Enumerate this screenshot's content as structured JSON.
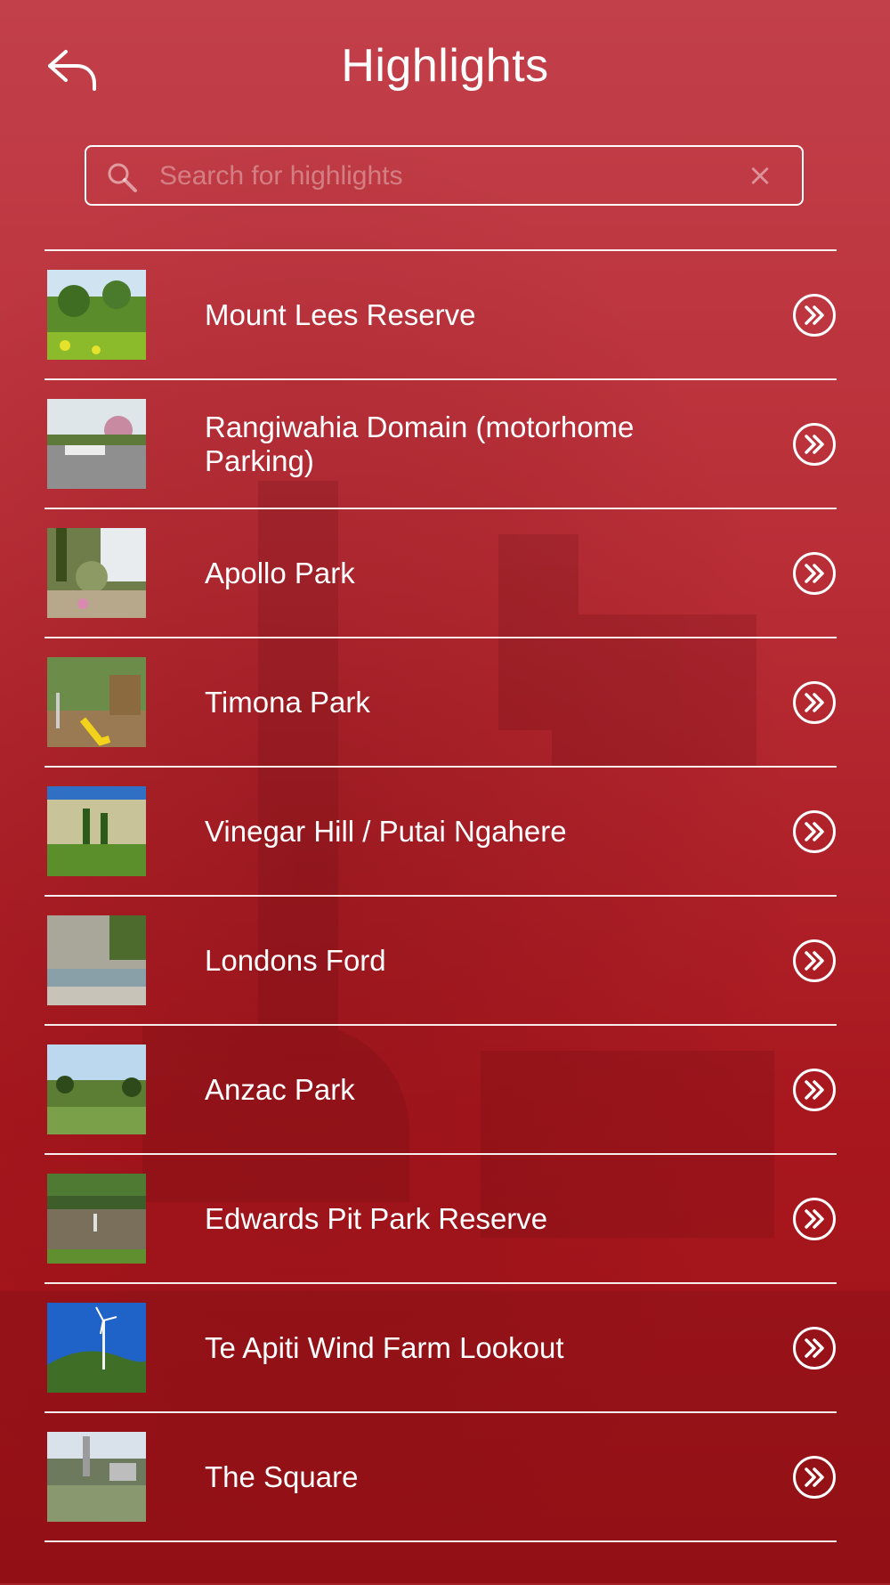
{
  "header": {
    "title": "Highlights",
    "back_icon": "back-arrow-icon"
  },
  "search": {
    "placeholder": "Search for highlights",
    "value": "",
    "clear_label": "×"
  },
  "items": [
    {
      "label": "Mount Lees Reserve",
      "thumb": "park-garden"
    },
    {
      "label": "Rangiwahia Domain (motorhome Parking)",
      "thumb": "domain-blossom"
    },
    {
      "label": "Apollo Park",
      "thumb": "garden-plants"
    },
    {
      "label": "Timona Park",
      "thumb": "playground"
    },
    {
      "label": "Vinegar Hill / Putai Ngahere",
      "thumb": "cliff-trees"
    },
    {
      "label": "Londons Ford",
      "thumb": "river-cliff"
    },
    {
      "label": "Anzac Park",
      "thumb": "sky-field"
    },
    {
      "label": "Edwards Pit Park Reserve",
      "thumb": "pond"
    },
    {
      "label": "Te Apiti Wind Farm Lookout",
      "thumb": "wind-turbine"
    },
    {
      "label": "The Square",
      "thumb": "city-square"
    }
  ],
  "colors": {
    "background": "#b3252c",
    "text": "#ffffff"
  }
}
